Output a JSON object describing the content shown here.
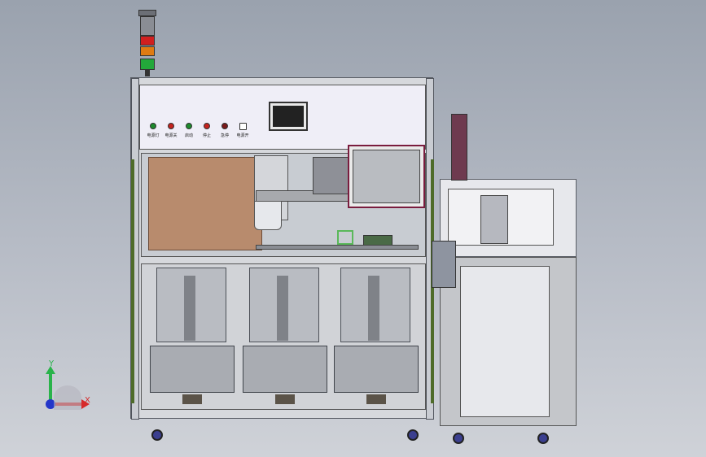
{
  "control_panel": {
    "buttons": [
      {
        "name": "power-indicator",
        "label": "电源灯",
        "color": "#1d8a2c"
      },
      {
        "name": "power-off-button",
        "label": "电源关",
        "color": "#c4231d"
      },
      {
        "name": "start-button",
        "label": "启动",
        "color": "#1d8a2c"
      },
      {
        "name": "stop-button",
        "label": "停止",
        "color": "#c4231d"
      },
      {
        "name": "emergency-stop-button",
        "label": "急停",
        "color": "#7a1a1a"
      },
      {
        "name": "power-switch",
        "label": "电源开",
        "color": "#333333"
      }
    ]
  },
  "signal_tower": {
    "segments": [
      "#d11f1f",
      "#e07b12",
      "#23a83a"
    ]
  },
  "axis_triad": {
    "y_label": "Y",
    "x_label": "X",
    "y_color": "#29b34a",
    "x_color": "#d62a2a",
    "z_color": "#2436c9"
  }
}
